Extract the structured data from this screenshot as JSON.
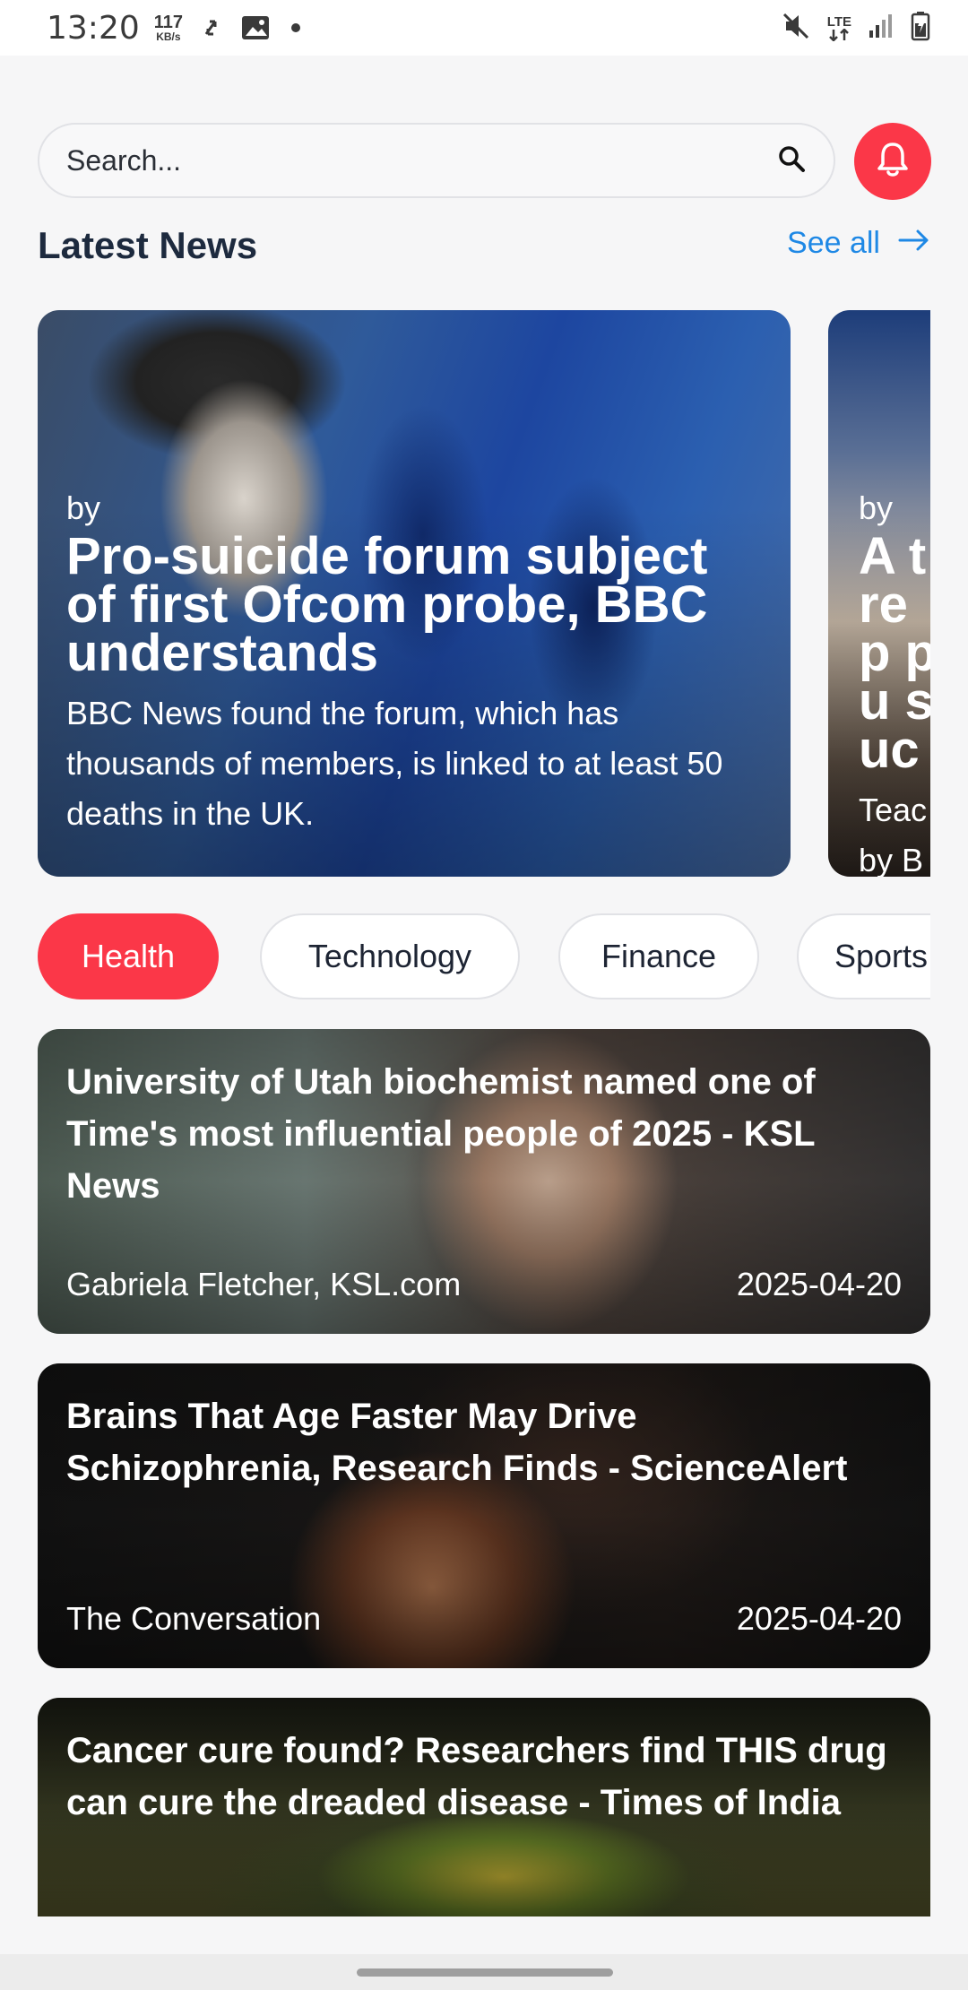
{
  "status_bar": {
    "time": "13:20",
    "speed_value": "117",
    "speed_unit": "KB/s",
    "network": "LTE",
    "icons": [
      "sync-icon",
      "image-icon",
      "dot-icon",
      "mute-icon",
      "lte-icon",
      "signal-icon",
      "battery-icon"
    ]
  },
  "search": {
    "placeholder": "Search..."
  },
  "latest": {
    "title": "Latest News",
    "see_all": "See all"
  },
  "carousel": [
    {
      "by": "by",
      "title": "Pro-suicide forum subject of first Ofcom probe, BBC understands",
      "description": "BBC News found the forum, which has thousands of members, is linked to at least 50 deaths in the UK."
    },
    {
      "by": "by",
      "title": "A t rep pu suc",
      "description": "Teac by B tackl"
    }
  ],
  "categories": [
    {
      "label": "Health",
      "active": true
    },
    {
      "label": "Technology",
      "active": false
    },
    {
      "label": "Finance",
      "active": false
    },
    {
      "label": "Sports",
      "active": false
    }
  ],
  "articles": [
    {
      "title": "University of Utah biochemist named one of Time's most influential people of 2025 - KSL News",
      "source": "Gabriela Fletcher, KSL.com",
      "date": "2025-04-20"
    },
    {
      "title": "Brains That Age Faster May Drive Schizophrenia, Research Finds - ScienceAlert",
      "source": "The Conversation",
      "date": "2025-04-20"
    },
    {
      "title": "Cancer cure found? Researchers find THIS drug can cure the dreaded disease - Times of India",
      "source": "",
      "date": ""
    }
  ],
  "colors": {
    "accent_red": "#fb3748",
    "link_blue": "#1e88e5",
    "heading": "#1d2a3e",
    "background": "#f6f6f7"
  }
}
